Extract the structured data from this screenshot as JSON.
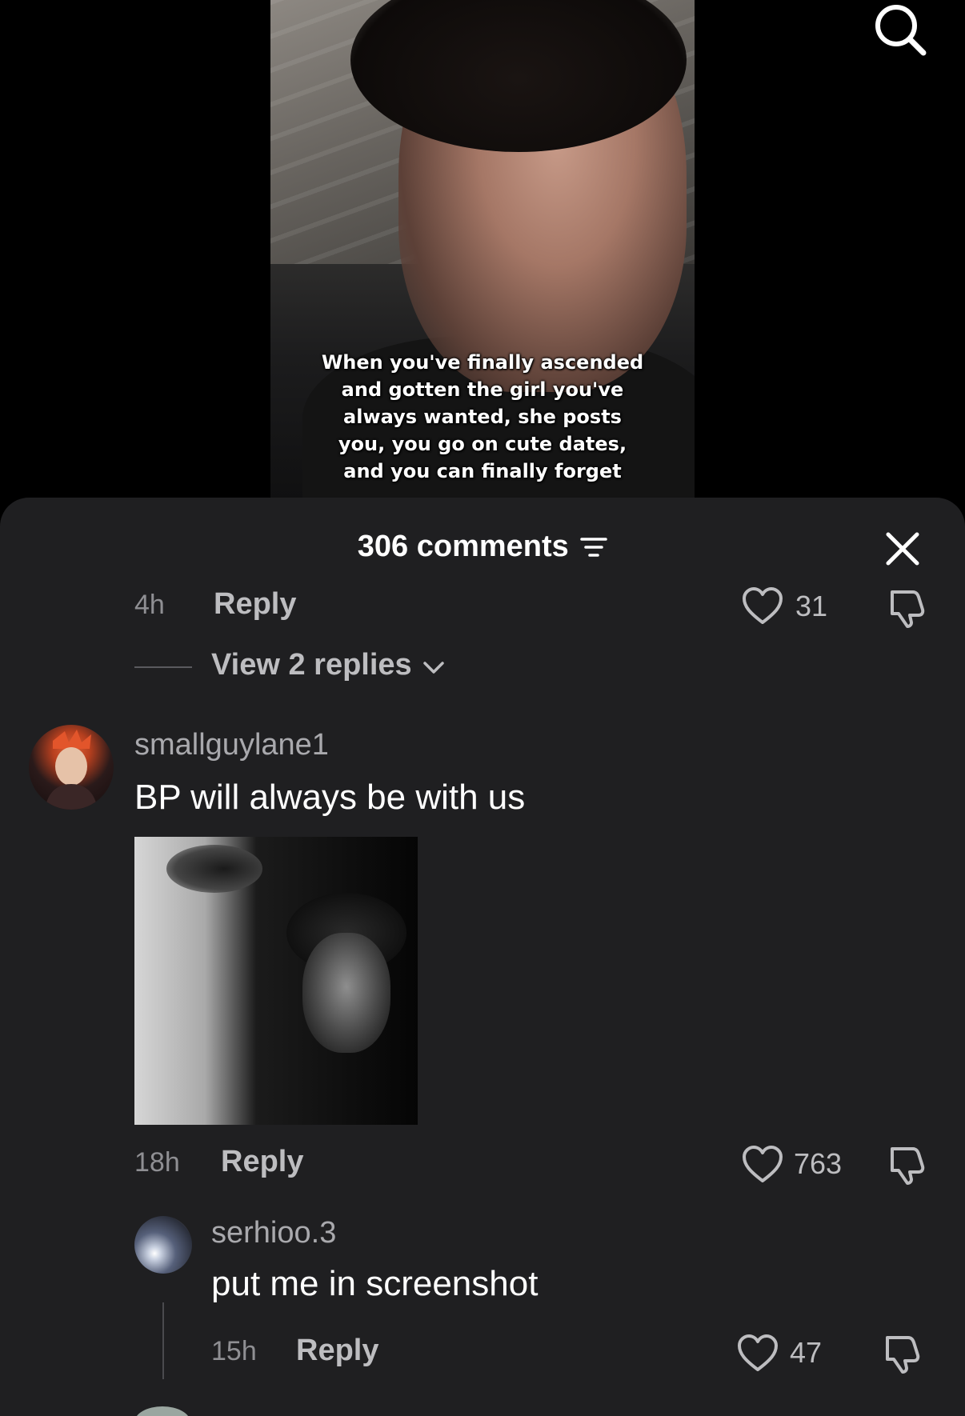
{
  "video": {
    "caption_lines": [
      "When you've finally ascended",
      "and gotten the girl you've",
      "always wanted, she posts",
      "you, you go on cute dates,",
      "and you can finally forget"
    ]
  },
  "sheet": {
    "comments_count": "306 comments"
  },
  "comments": [
    {
      "time": "4h",
      "reply_label": "Reply",
      "likes": "31",
      "view_replies": "View 2 replies"
    },
    {
      "username": "smallguylane1",
      "text": "BP will always be with us",
      "time": "18h",
      "reply_label": "Reply",
      "likes": "763"
    },
    {
      "username": "serhioo.3",
      "text": "put me in screenshot",
      "time": "15h",
      "reply_label": "Reply",
      "likes": "47"
    }
  ],
  "colors": {
    "sheet_bg": "#1f1f21",
    "muted_text": "#8f8f93",
    "secondary_text": "#bdbdc0"
  },
  "icons": [
    "search-icon",
    "filter-icon",
    "close-icon",
    "heart-icon",
    "dislike-icon",
    "chevron-down-icon"
  ]
}
